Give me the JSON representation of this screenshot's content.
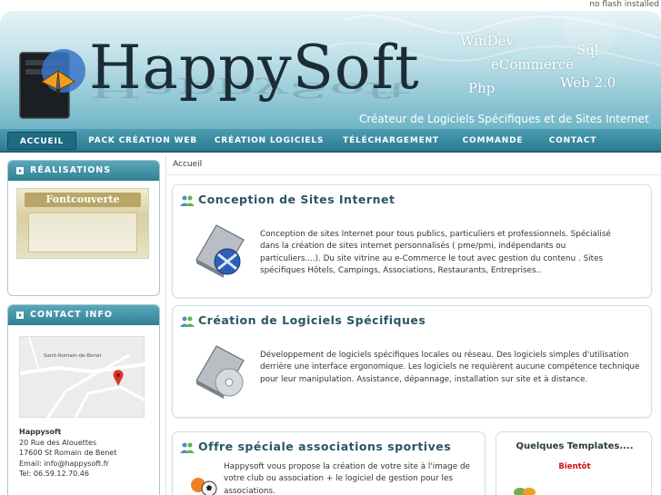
{
  "top_note": "no flash installed",
  "header": {
    "brand": "HappySoft",
    "keywords": [
      "WinDev",
      "Sql",
      "eCommerce",
      "Php",
      "Web 2.0"
    ],
    "tagline": "Créateur de Logiciels Spécifiques et de Sites Internet"
  },
  "nav": {
    "items": [
      "ACCUEIL",
      "PACK CRÉATION WEB",
      "CRÉATION LOGICIELS",
      "TÉLÉCHARGEMENT",
      "COMMANDE",
      "CONTACT"
    ],
    "active": "ACCUEIL"
  },
  "sidebar": {
    "realisations_title": "RÉALISATIONS",
    "thumb_caption": "Fontcouverte",
    "contact_title": "CONTACT INFO",
    "map_label": "Saint-Romain-de-Benet",
    "contact": {
      "name": "Happysoft",
      "street": "20 Rue des Alouettes",
      "city": "17600 St Romain de Benet",
      "email": "Email: info@happysoft.fr",
      "tel": "Tel: 06.59.12.70.46"
    }
  },
  "main": {
    "breadcrumb": "Accueil",
    "sections": [
      {
        "title": "Conception de Sites Internet",
        "text": "Conception de sites Internet pour tous publics, particuliers et professionnels. Spécialisé dans la création de sites internet personnalisés ( pme/pmi, indépendants ou particuliers....). Du site vitrine au e-Commerce le tout avec gestion du contenu . Sites spécifiques Hôtels, Campings, Associations, Restaurants, Entreprises.."
      },
      {
        "title": "Création de Logiciels Spécifiques",
        "text": "Développement de logiciels spécifiques locales ou réseau. Des logiciels simples d'utilisation derrière une interface ergonomique. Les logiciels ne requièrent aucune compétence technique pour leur manipulation. Assistance, dépannage, installation sur site et à distance."
      },
      {
        "title": "Offre spéciale associations sportives",
        "text": "Happysoft vous propose la création de votre site à l'image de votre club ou association + le logiciel de gestion pour les associations."
      }
    ],
    "templates_title": "Quelques Templates....",
    "templates_status": "Bientôt"
  },
  "colors": {
    "nav_bg": "#2c7b90",
    "title_text": "#2a5565",
    "accent_red": "#cc1111"
  }
}
